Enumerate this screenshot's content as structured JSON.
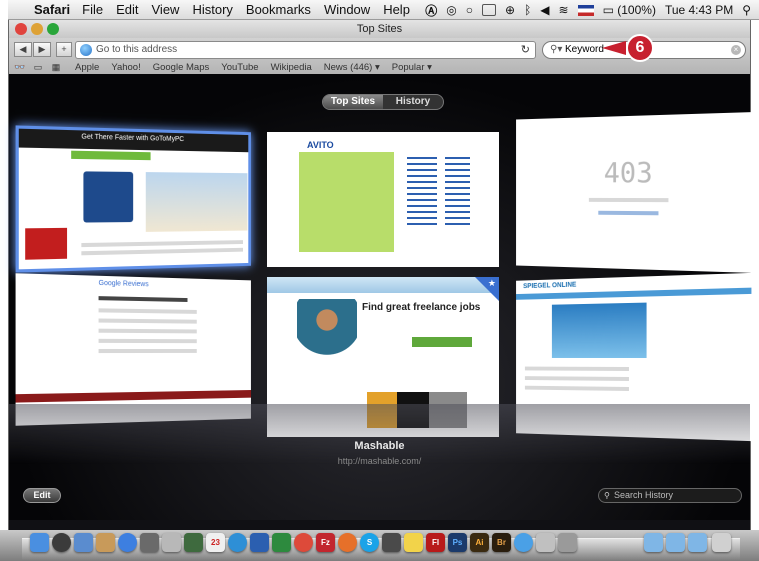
{
  "menubar": {
    "app": "Safari",
    "menus": [
      "File",
      "Edit",
      "View",
      "History",
      "Bookmarks",
      "Window",
      "Help"
    ],
    "battery": "(100%)",
    "clock": "Tue 4:43 PM"
  },
  "window": {
    "title": "Top Sites"
  },
  "toolbar": {
    "address_placeholder": "Go to this address",
    "search_value": "Keyword"
  },
  "bookmarks": [
    "Apple",
    "Yahoo!",
    "Google Maps",
    "YouTube",
    "Wikipedia",
    "News (446) ▾",
    "Popular ▾"
  ],
  "callout": "6",
  "topsites": {
    "tabs": [
      "Top Sites",
      "History"
    ],
    "selected_site_name": "Mashable",
    "selected_site_url": "http://mashable.com/",
    "edit_label": "Edit",
    "search_history_placeholder": "Search History",
    "thumbs": [
      {
        "text": "Get There Faster with GoToMyPC"
      },
      {
        "text": "AVITO"
      },
      {
        "text": "403"
      },
      {
        "text": "Google Reviews"
      },
      {
        "text": "Find great freelance jobs"
      },
      {
        "text": "SPIEGEL ONLINE"
      }
    ]
  },
  "dock": {
    "icons": [
      "finder-icon",
      "dashboard-icon",
      "mail-icon",
      "contacts-icon",
      "itunes-icon",
      "facetime-icon",
      "dictionary-icon",
      "photos-icon",
      "calendar-icon",
      "safari-icon",
      "word-icon",
      "excel-icon",
      "chrome-icon",
      "filezilla-icon",
      "firefox-icon",
      "skype-icon",
      "preview-icon",
      "notes-icon",
      "flash-icon",
      "photoshop-icon",
      "illustrator-icon",
      "bridge-icon",
      "app-store-icon",
      "utilities-icon",
      "folder-icon",
      "folder-icon-2",
      "folder-icon-3",
      "trash-icon"
    ],
    "labels": {
      "photoshop": "Ps",
      "illustrator": "Ai",
      "bridge": "Br",
      "flash": "Fl",
      "filezilla": "Fz",
      "skype": "S",
      "calendar": "23"
    }
  }
}
